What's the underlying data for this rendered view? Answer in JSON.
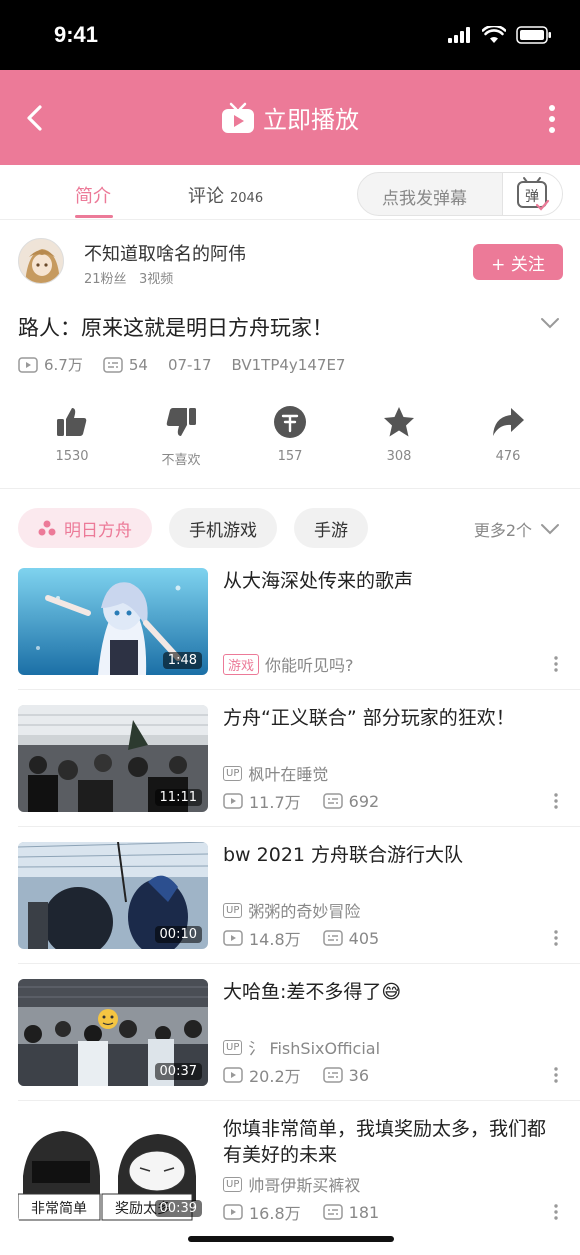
{
  "status_bar": {
    "time": "9:41"
  },
  "navbar": {
    "title": "立即播放"
  },
  "tabs": [
    {
      "label": "简介",
      "active": true
    },
    {
      "label": "评论",
      "count": "2046",
      "active": false
    }
  ],
  "danmu": {
    "placeholder": "点我发弹幕",
    "button_label": "弹"
  },
  "uploader": {
    "name": "不知道取啥名的阿伟",
    "fans": "21粉丝",
    "videos": "3视频",
    "follow_label": "+ 关注"
  },
  "video": {
    "title": "路人：原来这就是明日方舟玩家！",
    "views": "6.7万",
    "danmaku": "54",
    "date": "07-17",
    "bvid": "BV1TP4y147E7"
  },
  "actions": [
    {
      "name": "like",
      "label": "1530"
    },
    {
      "name": "dislike",
      "label": "不喜欢"
    },
    {
      "name": "coin",
      "label": "157"
    },
    {
      "name": "favorite",
      "label": "308"
    },
    {
      "name": "share",
      "label": "476"
    }
  ],
  "tags": [
    {
      "label": "明日方舟",
      "highlight": true
    },
    {
      "label": "手机游戏",
      "highlight": false
    },
    {
      "label": "手游",
      "highlight": false
    }
  ],
  "tags_more": "更多2个",
  "related": [
    {
      "title": "从大海深处传来的歌声",
      "duration": "1:48",
      "game_tag": "游戏",
      "subtitle": "你能听见吗?"
    },
    {
      "title": "方舟“正义联合”   部分玩家的狂欢！",
      "duration": "11:11",
      "up": "枫叶在睡觉",
      "views": "11.7万",
      "danmaku": "692"
    },
    {
      "title": "bw  2021  方舟联合游行大队",
      "duration": "00:10",
      "up": "粥粥的奇妙冒险",
      "views": "14.8万",
      "danmaku": "405"
    },
    {
      "title": "大哈鱼:差不多得了😅",
      "duration": "00:37",
      "up": "氵 FishSixOfficial",
      "views": "20.2万",
      "danmaku": "36"
    },
    {
      "title": "你填非常简单，我填奖励太多，我们都有美好的未来",
      "duration": "00:39",
      "up": "帅哥伊斯买裤衩",
      "views": "16.8万",
      "danmaku": "181",
      "thumb_text_left": "非常简单",
      "thumb_text_right": "奖励太多"
    }
  ],
  "up_badge": "UP",
  "colors": {
    "accent": "#ec7a98",
    "text_gray": "#888888"
  }
}
